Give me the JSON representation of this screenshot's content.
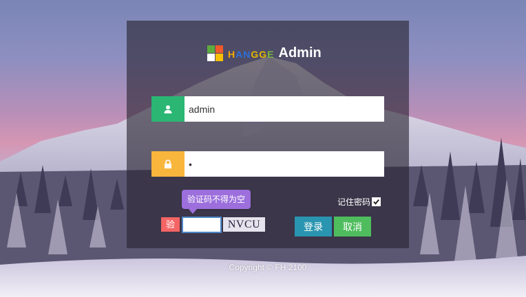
{
  "brand": {
    "letters": [
      "H",
      "A",
      "N",
      "G",
      "G",
      "E"
    ],
    "letter_colors": [
      "#f7a800",
      "#2e6fd8",
      "#2e6fd8",
      "#e6b900",
      "#e6b900",
      "#7bb83e"
    ],
    "title": "Admin",
    "logo_colors": [
      "#5dab3f",
      "#f05a28",
      "#ffffff",
      "#f7c000"
    ]
  },
  "username": {
    "value": "admin",
    "icon": "user-icon",
    "accent": "#2bb673"
  },
  "password": {
    "value": "•",
    "icon": "lock-icon",
    "accent": "#f9b63d"
  },
  "remember": {
    "label": "记住密码",
    "checked": true
  },
  "captcha": {
    "label": "验",
    "value": "",
    "code": "NVCU",
    "tooltip": "验证码不得为空"
  },
  "buttons": {
    "login": "登录",
    "cancel": "取消"
  },
  "footer": {
    "copyright": "Copyright © FH 2100"
  }
}
